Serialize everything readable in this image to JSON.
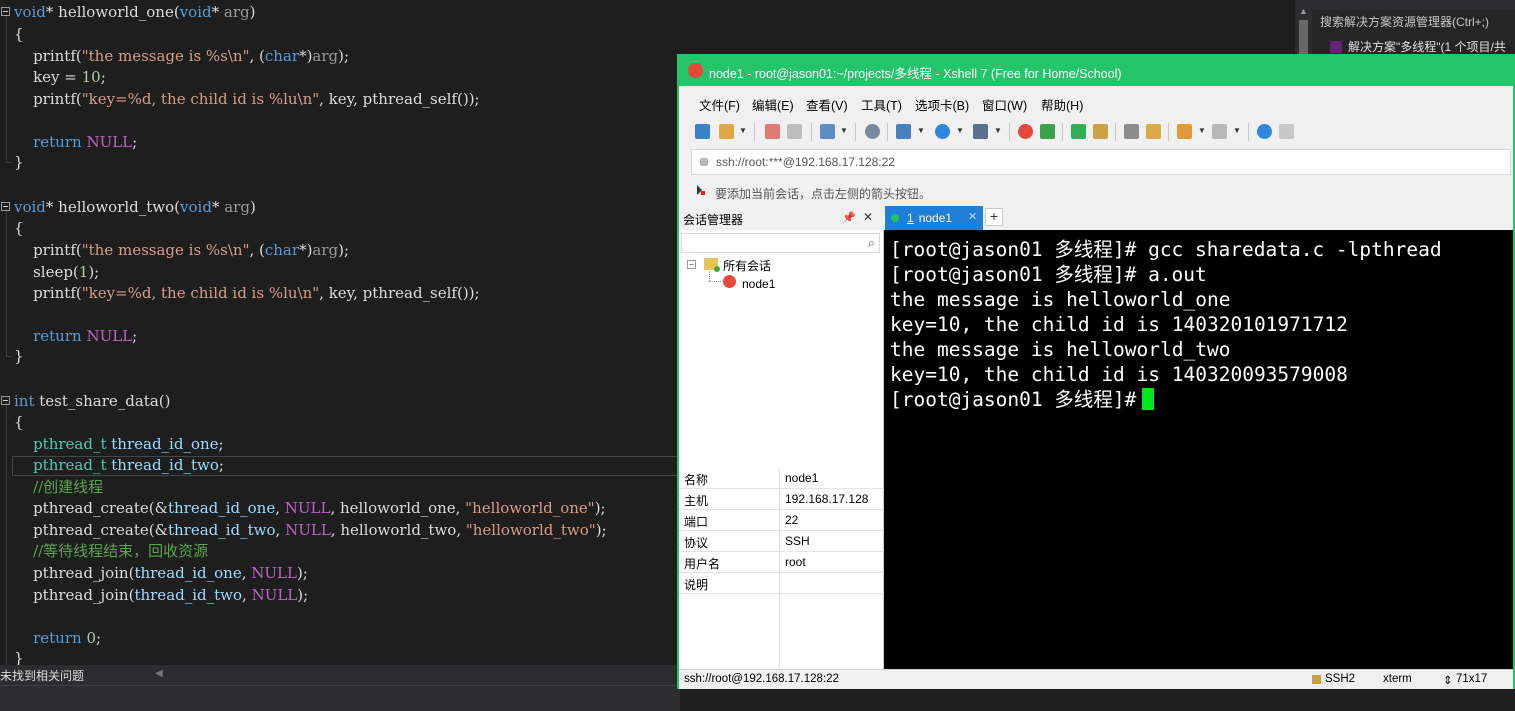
{
  "editor": {
    "lines": [
      {
        "t": 2,
        "fold": true,
        "spans": [
          {
            "c": "#569cd6",
            "t": "void"
          },
          {
            "c": "#dcdcdc",
            "t": "* helloworld_one("
          },
          {
            "c": "#569cd6",
            "t": "void"
          },
          {
            "c": "#dcdcdc",
            "t": "* "
          },
          {
            "c": "#9a9a9a",
            "t": "arg"
          },
          {
            "c": "#dcdcdc",
            "t": ")"
          }
        ]
      },
      {
        "t": 24,
        "fold": false,
        "spans": [
          {
            "c": "#dcdcdc",
            "t": "{"
          }
        ]
      },
      {
        "t": 46,
        "fold": false,
        "spans": [
          {
            "c": "#dcdcdc",
            "t": "    printf("
          },
          {
            "c": "#d69d85",
            "t": "\"the message is %s\\n\""
          },
          {
            "c": "#dcdcdc",
            "t": ", ("
          },
          {
            "c": "#569cd6",
            "t": "char"
          },
          {
            "c": "#dcdcdc",
            "t": "*)"
          },
          {
            "c": "#9a9a9a",
            "t": "arg"
          },
          {
            "c": "#dcdcdc",
            "t": ");"
          }
        ]
      },
      {
        "t": 67,
        "fold": false,
        "spans": [
          {
            "c": "#dcdcdc",
            "t": "    key = "
          },
          {
            "c": "#b5cea8",
            "t": "10"
          },
          {
            "c": "#dcdcdc",
            "t": ";"
          }
        ]
      },
      {
        "t": 89,
        "fold": false,
        "spans": [
          {
            "c": "#dcdcdc",
            "t": "    printf("
          },
          {
            "c": "#d69d85",
            "t": "\"key=%d, the child id is %lu\\n\""
          },
          {
            "c": "#dcdcdc",
            "t": ", key, pthread_self());"
          }
        ]
      },
      {
        "t": 132,
        "fold": false,
        "spans": [
          {
            "c": "#dcdcdc",
            "t": "    "
          },
          {
            "c": "#569cd6",
            "t": "return"
          },
          {
            "c": "#dcdcdc",
            "t": " "
          },
          {
            "c": "#bd63c5",
            "t": "NULL"
          },
          {
            "c": "#dcdcdc",
            "t": ";"
          }
        ]
      },
      {
        "t": 152,
        "fold": false,
        "spans": [
          {
            "c": "#dcdcdc",
            "t": "}"
          }
        ]
      },
      {
        "t": 197,
        "fold": true,
        "spans": [
          {
            "c": "#569cd6",
            "t": "void"
          },
          {
            "c": "#dcdcdc",
            "t": "* helloworld_two("
          },
          {
            "c": "#569cd6",
            "t": "void"
          },
          {
            "c": "#dcdcdc",
            "t": "* "
          },
          {
            "c": "#9a9a9a",
            "t": "arg"
          },
          {
            "c": "#dcdcdc",
            "t": ")"
          }
        ]
      },
      {
        "t": 218,
        "fold": false,
        "spans": [
          {
            "c": "#dcdcdc",
            "t": "{"
          }
        ]
      },
      {
        "t": 240,
        "fold": false,
        "spans": [
          {
            "c": "#dcdcdc",
            "t": "    printf("
          },
          {
            "c": "#d69d85",
            "t": "\"the message is %s\\n\""
          },
          {
            "c": "#dcdcdc",
            "t": ", ("
          },
          {
            "c": "#569cd6",
            "t": "char"
          },
          {
            "c": "#dcdcdc",
            "t": "*)"
          },
          {
            "c": "#9a9a9a",
            "t": "arg"
          },
          {
            "c": "#dcdcdc",
            "t": ");"
          }
        ]
      },
      {
        "t": 262,
        "fold": false,
        "spans": [
          {
            "c": "#dcdcdc",
            "t": "    sleep("
          },
          {
            "c": "#b5cea8",
            "t": "1"
          },
          {
            "c": "#dcdcdc",
            "t": ");"
          }
        ]
      },
      {
        "t": 283,
        "fold": false,
        "spans": [
          {
            "c": "#dcdcdc",
            "t": "    printf("
          },
          {
            "c": "#d69d85",
            "t": "\"key=%d, the child id is %lu\\n\""
          },
          {
            "c": "#dcdcdc",
            "t": ", key, pthread_self());"
          }
        ]
      },
      {
        "t": 326,
        "fold": false,
        "spans": [
          {
            "c": "#dcdcdc",
            "t": "    "
          },
          {
            "c": "#569cd6",
            "t": "return"
          },
          {
            "c": "#dcdcdc",
            "t": " "
          },
          {
            "c": "#bd63c5",
            "t": "NULL"
          },
          {
            "c": "#dcdcdc",
            "t": ";"
          }
        ]
      },
      {
        "t": 346,
        "fold": false,
        "spans": [
          {
            "c": "#dcdcdc",
            "t": "}"
          }
        ]
      },
      {
        "t": 391,
        "fold": true,
        "spans": [
          {
            "c": "#569cd6",
            "t": "int"
          },
          {
            "c": "#dcdcdc",
            "t": " test_share_data()"
          }
        ]
      },
      {
        "t": 412,
        "fold": false,
        "spans": [
          {
            "c": "#dcdcdc",
            "t": "{"
          }
        ]
      },
      {
        "t": 434,
        "fold": false,
        "spans": [
          {
            "c": "#dcdcdc",
            "t": "    "
          },
          {
            "c": "#4ec9b0",
            "t": "pthread_t"
          },
          {
            "c": "#dcdcdc",
            "t": " "
          },
          {
            "c": "#9cdcfe",
            "t": "thread_id_one"
          },
          {
            "c": "#dcdcdc",
            "t": ";"
          }
        ]
      },
      {
        "t": 455,
        "fold": false,
        "spans": [
          {
            "c": "#dcdcdc",
            "t": "    "
          },
          {
            "c": "#4ec9b0",
            "t": "pthread_t"
          },
          {
            "c": "#dcdcdc",
            "t": " "
          },
          {
            "c": "#9cdcfe",
            "t": "thread_id_two"
          },
          {
            "c": "#dcdcdc",
            "t": ";"
          }
        ]
      },
      {
        "t": 477,
        "fold": false,
        "spans": [
          {
            "c": "#dcdcdc",
            "t": "    "
          },
          {
            "c": "#57a64a",
            "t": "//创建线程"
          }
        ]
      },
      {
        "t": 498,
        "fold": false,
        "spans": [
          {
            "c": "#dcdcdc",
            "t": "    pthread_create(&"
          },
          {
            "c": "#9cdcfe",
            "t": "thread_id_one"
          },
          {
            "c": "#dcdcdc",
            "t": ", "
          },
          {
            "c": "#bd63c5",
            "t": "NULL"
          },
          {
            "c": "#dcdcdc",
            "t": ", helloworld_one, "
          },
          {
            "c": "#d69d85",
            "t": "\"helloworld_one\""
          },
          {
            "c": "#dcdcdc",
            "t": ");"
          }
        ]
      },
      {
        "t": 520,
        "fold": false,
        "spans": [
          {
            "c": "#dcdcdc",
            "t": "    pthread_create(&"
          },
          {
            "c": "#9cdcfe",
            "t": "thread_id_two"
          },
          {
            "c": "#dcdcdc",
            "t": ", "
          },
          {
            "c": "#bd63c5",
            "t": "NULL"
          },
          {
            "c": "#dcdcdc",
            "t": ", helloworld_two, "
          },
          {
            "c": "#d69d85",
            "t": "\"helloworld_two\""
          },
          {
            "c": "#dcdcdc",
            "t": ");"
          }
        ]
      },
      {
        "t": 541,
        "fold": false,
        "spans": [
          {
            "c": "#dcdcdc",
            "t": "    "
          },
          {
            "c": "#57a64a",
            "t": "//等待线程结束，回收资源"
          }
        ]
      },
      {
        "t": 563,
        "fold": false,
        "spans": [
          {
            "c": "#dcdcdc",
            "t": "    pthread_join("
          },
          {
            "c": "#9cdcfe",
            "t": "thread_id_one"
          },
          {
            "c": "#dcdcdc",
            "t": ", "
          },
          {
            "c": "#bd63c5",
            "t": "NULL"
          },
          {
            "c": "#dcdcdc",
            "t": ");"
          }
        ]
      },
      {
        "t": 585,
        "fold": false,
        "spans": [
          {
            "c": "#dcdcdc",
            "t": "    pthread_join("
          },
          {
            "c": "#9cdcfe",
            "t": "thread_id_two"
          },
          {
            "c": "#dcdcdc",
            "t": ", "
          },
          {
            "c": "#bd63c5",
            "t": "NULL"
          },
          {
            "c": "#dcdcdc",
            "t": ");"
          }
        ]
      },
      {
        "t": 628,
        "fold": false,
        "spans": [
          {
            "c": "#dcdcdc",
            "t": "    "
          },
          {
            "c": "#569cd6",
            "t": "return"
          },
          {
            "c": "#dcdcdc",
            "t": " "
          },
          {
            "c": "#b5cea8",
            "t": "0"
          },
          {
            "c": "#dcdcdc",
            "t": ";"
          }
        ]
      },
      {
        "t": 648,
        "fold": false,
        "spans": [
          {
            "c": "#dcdcdc",
            "t": "}"
          }
        ]
      }
    ]
  },
  "solution_explorer": {
    "search_placeholder": "搜索解决方案资源管理器(Ctrl+;)",
    "root_label": "解决方案\"多线程\"(1 个项目/共"
  },
  "vs_status": {
    "message": "未找到相关问题"
  },
  "xshell": {
    "title": "node1 - root@jason01:~/projects/多线程 - Xshell 7 (Free for Home/School)",
    "menu": [
      "文件(F)",
      "编辑(E)",
      "查看(V)",
      "工具(T)",
      "选项卡(B)",
      "窗口(W)",
      "帮助(H)"
    ],
    "address": "ssh://root:***@192.168.17.128:22",
    "hint": "要添加当前会话，点击左侧的箭头按钮。",
    "session_manager": {
      "title": "会话管理器",
      "tree_root": "所有会话",
      "tree_child": "node1"
    },
    "properties": [
      {
        "k": "名称",
        "v": "node1"
      },
      {
        "k": "主机",
        "v": "192.168.17.128"
      },
      {
        "k": "端口",
        "v": "22"
      },
      {
        "k": "协议",
        "v": "SSH"
      },
      {
        "k": "用户名",
        "v": "root"
      },
      {
        "k": "说明",
        "v": ""
      }
    ],
    "tab": {
      "index": "1",
      "label": "node1"
    },
    "terminal_lines": [
      "[root@jason01 多线程]# gcc sharedata.c -lpthread",
      "[root@jason01 多线程]# a.out",
      "the message is helloworld_one",
      "key=10, the child id is 140320101971712",
      "the message is helloworld_two",
      "key=10, the child id is 140320093579008",
      "[root@jason01 多线程]#"
    ],
    "status": {
      "connection": "ssh://root@192.168.17.128:22",
      "protocol": "SSH2",
      "terminal": "xterm",
      "size": "71x17"
    }
  }
}
